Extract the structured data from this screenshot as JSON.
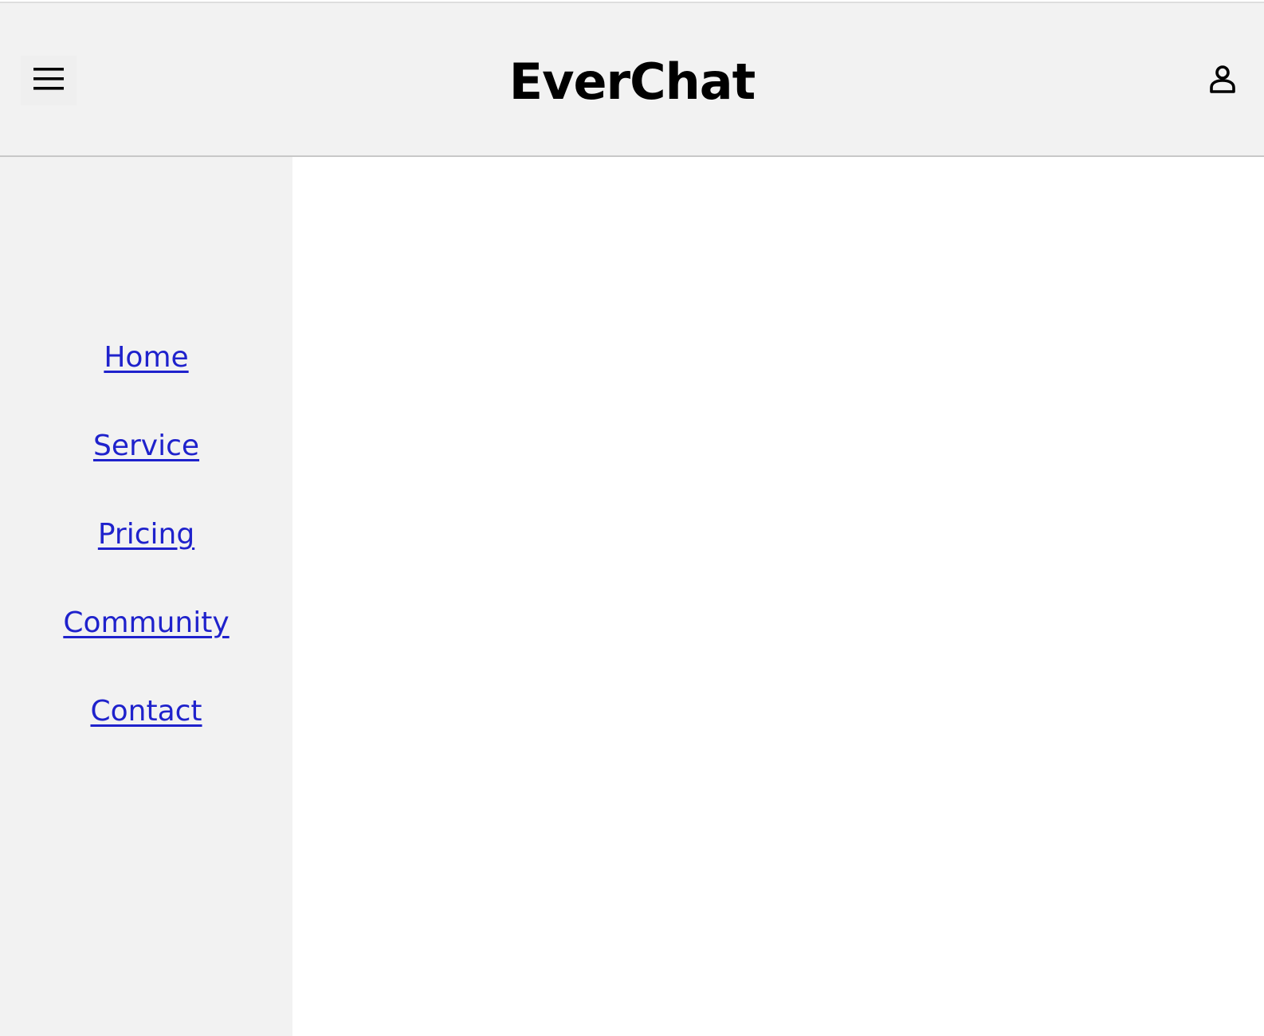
{
  "header": {
    "title": "EverChat",
    "menu_icon": "hamburger-menu-icon",
    "user_icon": "user-profile-icon"
  },
  "sidebar": {
    "items": [
      {
        "label": "Home"
      },
      {
        "label": "Service"
      },
      {
        "label": "Pricing"
      },
      {
        "label": "Community"
      },
      {
        "label": "Contact"
      }
    ]
  },
  "colors": {
    "header_background": "#f2f2f2",
    "sidebar_background": "#f2f2f2",
    "link": "#1f22cc",
    "title": "#000000",
    "content_background": "#ffffff"
  }
}
